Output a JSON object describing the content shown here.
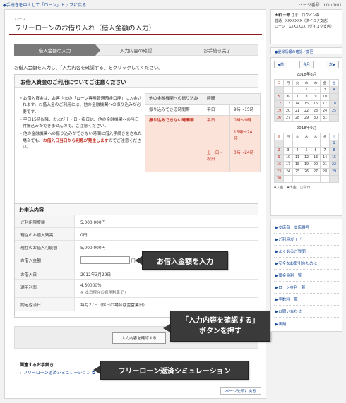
{
  "topbar": {
    "back_link": "◆手続きを中止して「ローン」トップに戻る",
    "page_number": "ページ番号：LOnf001"
  },
  "header": {
    "category": "ローン",
    "title": "フリーローンのお借り入れ（借入金額の入力）"
  },
  "steps": [
    {
      "label": "借入金額の入力",
      "active": true
    },
    {
      "label": "入力内容の確認",
      "active": false
    },
    {
      "label": "お手続き完了",
      "active": false
    }
  ],
  "intro": "お借入金額を入力し、「入力内容を確認する」をクリックしてください。",
  "notice": {
    "heading": "お借入資金のご利用についてご注意ください",
    "bullets": [
      "・お借入資金は、お客さまの「ローン専用普通預金口座」に入金されます。お借入金のご利用には、他の金融機関への振り込みが必要です。",
      "・平日15時以降、および土・日・祝日は、他の金融機関への当日付振込みができませんので、ご注意ください。",
      "・他の金融機関への振り込みができない時間に借入手続きをされた場合でも、"
    ],
    "bullet_red": "お借入日当日から利息が発生します",
    "bullet_tail": "のでご注意ください。",
    "table": {
      "h1": "他の金融機関への振り込み",
      "h2": "時間",
      "row1_label": "振り込みできる時間帯",
      "row1_day": "平日",
      "row1_time": "9時〜15時",
      "row2_label": "振り込みできない時間帯",
      "row2_day1": "平日",
      "row2_time1a": "0時〜9時",
      "row2_time1b": "15時〜24時",
      "row2_day2": "土・日・祝日",
      "row2_time2": "0時〜24時"
    }
  },
  "apply": {
    "heading": "お申込内容",
    "rows": [
      {
        "label": "ご利用限度額",
        "value": "5,000,000円"
      },
      {
        "label": "現在のお借入残高",
        "value": "0円"
      },
      {
        "label": "現在のお借入可能額",
        "value": "5,000,000円"
      },
      {
        "label": "お借入金額",
        "value": "円"
      },
      {
        "label": "お借入日",
        "value": "2012年3月29日"
      },
      {
        "label": "適用利率",
        "value": "4.50000%"
      },
      {
        "label": "約定返済日",
        "value": "毎月27日（休日の場合は翌営業日）"
      }
    ],
    "rate_note": "※ 本日現在の適用利率です"
  },
  "buttons": {
    "confirm": "入力内容を確認する",
    "page_top": "ページ先頭に戻る"
  },
  "related": {
    "heading": "関連するお手続き",
    "link": "フリーローン返済シミュレーション"
  },
  "callouts": {
    "c1": "お借入金額を入力",
    "c2_line1": "「入力内容を確認する」",
    "c2_line2": "ボタンを押す",
    "c3": "フリーローン返済シミュレーション"
  },
  "sidebar": {
    "user_name": "大和 一郎",
    "user_suffix": "さま　ログイン中",
    "acct1": "普通　XXXXXXX（ダイコク支店）",
    "acct2": "ローン　XXXXXXX（ダイコク支店）",
    "reg_link": "●登録情報の確認／変更",
    "prev": "◀前",
    "today": "今月",
    "next": "次▶",
    "cal1_title": "2018年8月",
    "cal2_title": "2018年9月",
    "weekdays": [
      "日",
      "月",
      "火",
      "水",
      "木",
      "金",
      "土"
    ],
    "cal1": [
      [
        "",
        "",
        "",
        "1",
        "2",
        "3",
        "4"
      ],
      [
        "5",
        "6",
        "7",
        "8",
        "9",
        "10",
        "11"
      ],
      [
        "12",
        "13",
        "14",
        "15",
        "16",
        "17",
        "18"
      ],
      [
        "19",
        "20",
        "21",
        "22",
        "23",
        "24",
        "25"
      ],
      [
        "26",
        "27",
        "28",
        "29",
        "30",
        "31",
        ""
      ]
    ],
    "cal2": [
      [
        "",
        "",
        "",
        "",
        "",
        "",
        "1"
      ],
      [
        "2",
        "3",
        "4",
        "5",
        "6",
        "7",
        "8"
      ],
      [
        "9",
        "10",
        "11",
        "12",
        "13",
        "14",
        "15"
      ],
      [
        "16",
        "17",
        "18",
        "19",
        "20",
        "21",
        "22"
      ],
      [
        "23",
        "24",
        "25",
        "26",
        "27",
        "28",
        "29"
      ],
      [
        "30",
        "",
        "",
        "",
        "",
        "",
        ""
      ]
    ],
    "legend": "▪入金　▪出金　□今日",
    "links": [
      "▶支店名・支店番号",
      "▶ご利用ガイド",
      "▶よくあるご質問",
      "▶安全なお取引のために",
      "▶預金金利一覧",
      "▶ローン金利一覧",
      "▶手数料一覧",
      "▶お問い合わせ",
      "▶店舗"
    ]
  },
  "colors": {
    "title_rule": "#8b1a1a",
    "active_step": "#7a7a7a",
    "warning_red": "#c0271a",
    "link_blue": "#1a4b9b",
    "pink_cell": "#fbe3d9",
    "callout_bg": "#3a3a3a"
  }
}
